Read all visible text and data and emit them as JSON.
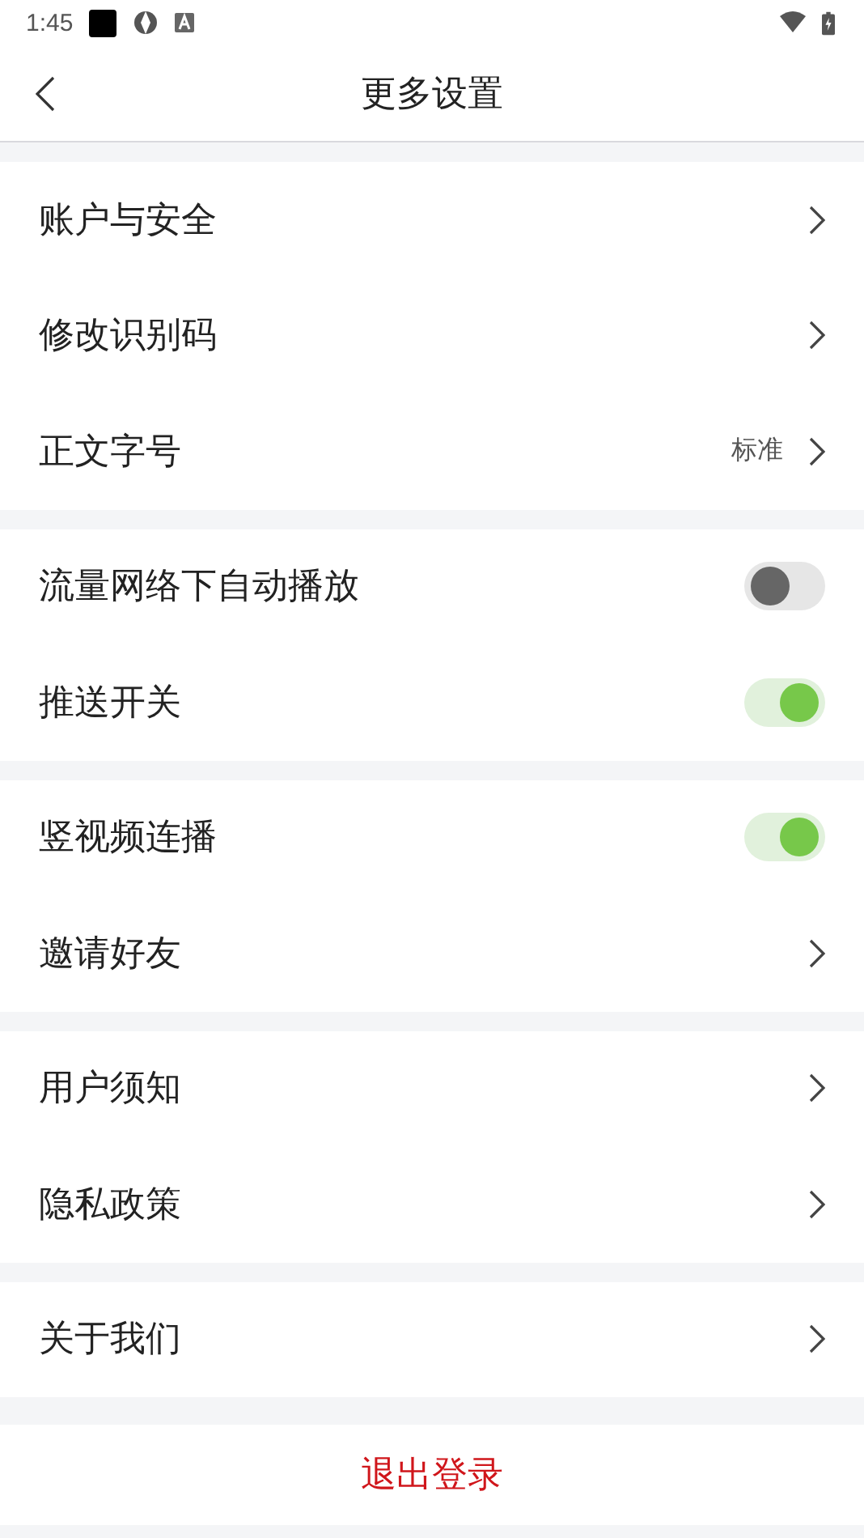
{
  "status_bar": {
    "time": "1:45"
  },
  "header": {
    "title": "更多设置"
  },
  "sections": [
    {
      "rows": [
        {
          "kind": "link",
          "label": "账户与安全"
        },
        {
          "kind": "link",
          "label": "修改识别码"
        },
        {
          "kind": "link",
          "label": "正文字号",
          "value": "标准"
        }
      ]
    },
    {
      "rows": [
        {
          "kind": "toggle",
          "label": "流量网络下自动播放",
          "on": false
        },
        {
          "kind": "toggle",
          "label": "推送开关",
          "on": true
        }
      ]
    },
    {
      "rows": [
        {
          "kind": "toggle",
          "label": "竖视频连播",
          "on": true
        },
        {
          "kind": "link",
          "label": "邀请好友"
        }
      ]
    },
    {
      "rows": [
        {
          "kind": "link",
          "label": "用户须知"
        },
        {
          "kind": "link",
          "label": "隐私政策"
        }
      ]
    },
    {
      "rows": [
        {
          "kind": "link",
          "label": "关于我们"
        }
      ]
    }
  ],
  "logout_button": "退出登录"
}
